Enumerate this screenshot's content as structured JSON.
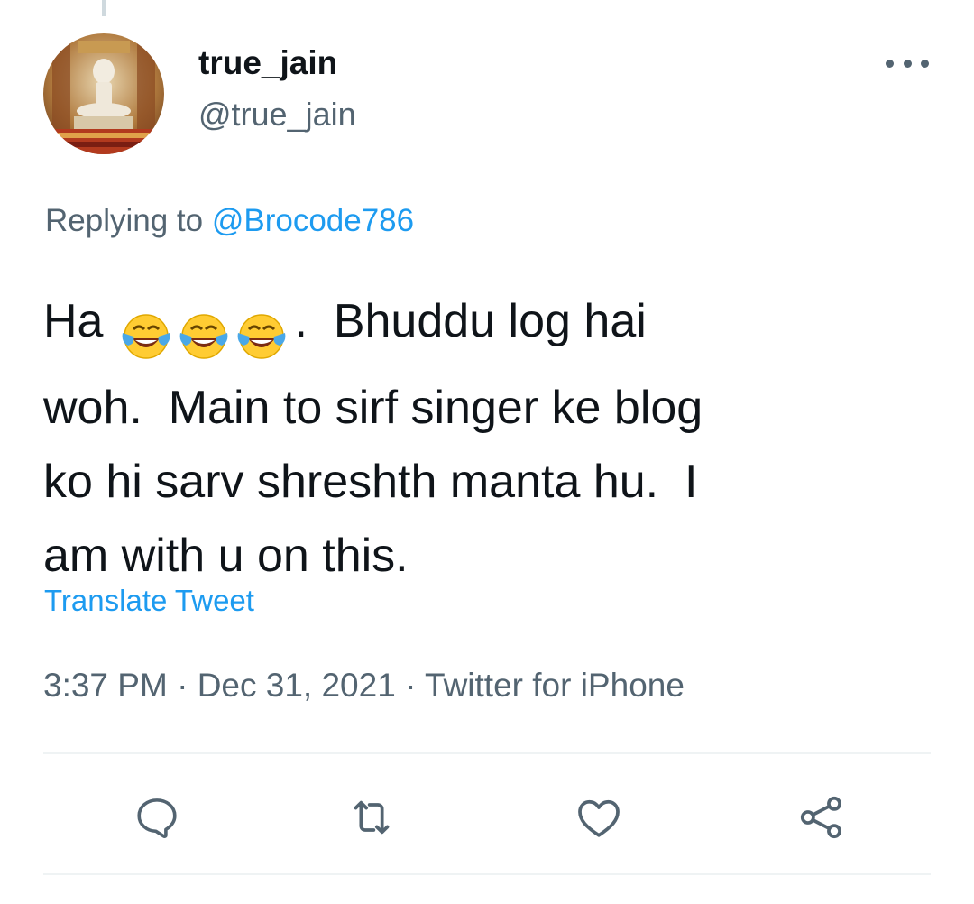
{
  "tweet": {
    "display_name": "true_jain",
    "handle": "@true_jain",
    "replying_prefix": "Replying to ",
    "replying_to": "@Brocode786",
    "text_lines": {
      "line1_start": "Ha",
      "line1_end": ".  Bhuddu log hai",
      "line2": "woh.  Main to sirf singer ke blog",
      "line3": "ko hi sarv shreshth manta hu.  I",
      "line4": "am with u on this."
    },
    "emoji_count": 3,
    "emoji_name": "face-with-tears-of-joy",
    "translate_label": "Translate Tweet",
    "time": "3:37 PM",
    "separator": " · ",
    "date": "Dec 31, 2021",
    "source": "Twitter for iPhone"
  },
  "colors": {
    "text_primary": "#0f1419",
    "text_secondary": "#536471",
    "link": "#1d9bf0",
    "divider": "#eff3f4"
  },
  "icons": {
    "more": "more-horizontal-icon",
    "reply": "reply-icon",
    "retweet": "retweet-icon",
    "like": "like-icon",
    "share": "share-icon"
  }
}
